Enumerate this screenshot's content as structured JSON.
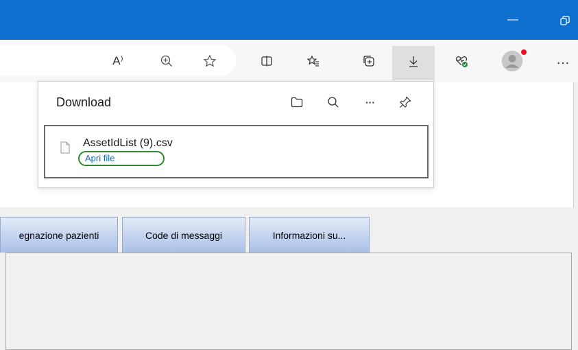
{
  "browser": {
    "toolbar_icons": [
      "read-aloud-icon",
      "zoom-icon",
      "favorite-star-icon",
      "split-screen-icon",
      "favorites-icon",
      "collections-icon",
      "download-icon",
      "health-icon",
      "profile-avatar-icon",
      "more-options-icon"
    ],
    "read_aloud_glyph": "A⁾",
    "more_glyph": "…",
    "minimize_glyph": "—"
  },
  "download_panel": {
    "title": "Download",
    "item": {
      "file_name": "AssetIdList (9).csv",
      "open_link": "Apri file"
    },
    "more_glyph": "···"
  },
  "page": {
    "tabs": [
      {
        "label": "egnazione pazienti"
      },
      {
        "label": "Code di messaggi"
      },
      {
        "label": "Informazioni su..."
      }
    ]
  },
  "colors": {
    "titlebar": "#0f6fcf",
    "highlight_ring": "#2b8a2b",
    "link": "#0f6cbd"
  }
}
